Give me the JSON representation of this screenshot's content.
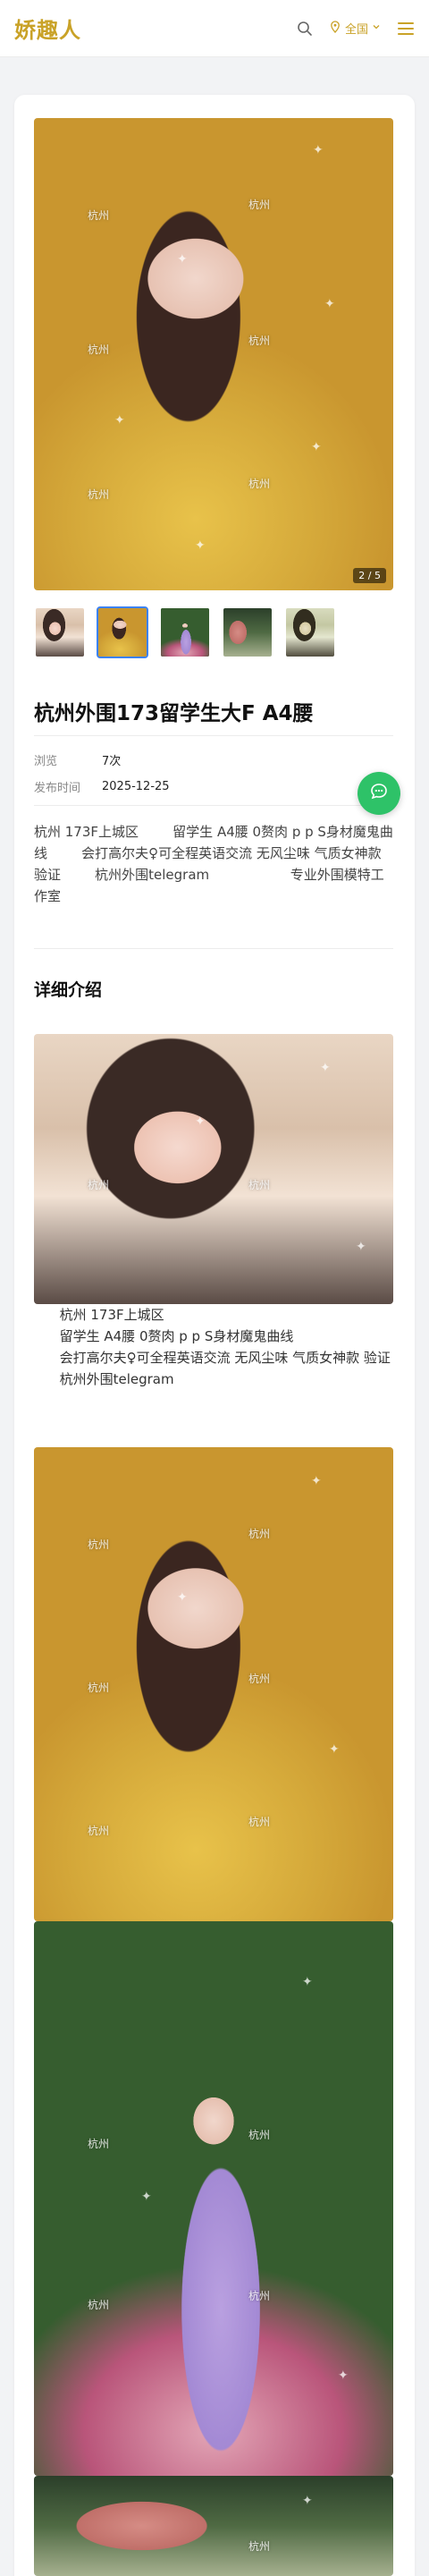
{
  "header": {
    "logo": "娇趣人",
    "region_label": "全国"
  },
  "gallery": {
    "counter": "2 / 5",
    "watermark": "杭州"
  },
  "post": {
    "title": "杭州外围173留学生大F A4腰",
    "meta": [
      {
        "label": "浏览",
        "value": "7次"
      },
      {
        "label": "发布时间",
        "value": "2025-12-25"
      }
    ],
    "description": "杭州 173F上城区        留学生 A4腰 0赘肉 ⁠p p S身材魔鬼曲线        会打高尔夫⁠♀可全程英语交流 无风尘味 气质女神款 ⁠验证        杭州外围telegram                   专业外围模特工作室"
  },
  "detail": {
    "section_title": "详细介绍",
    "text": "      杭州 173F上城区\n      留学生 A4腰 0赘肉 ⁠p p S身材魔鬼曲线\n      会打高尔夫⁠♀可全程英语交流 无风尘味 气质女神款 ⁠验证\n      杭州外围telegram"
  },
  "colors": {
    "brand_gold": "#c9a227",
    "accent_green": "#2ec268",
    "thumb_active": "#3b82f6"
  },
  "icons": {
    "search": "search-icon",
    "location": "location-pin-icon",
    "chevron": "chevron-down-icon",
    "menu": "menu-icon",
    "chat": "chat-icon"
  }
}
